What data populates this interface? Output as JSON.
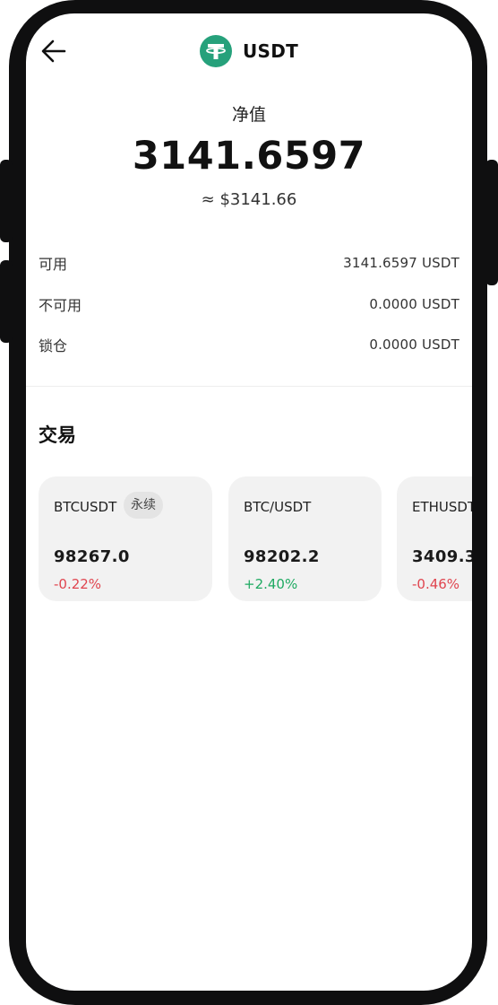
{
  "header": {
    "title": "USDT",
    "logo_icon": "tether-icon",
    "logo_color": "#26a17b"
  },
  "balance": {
    "label": "净值",
    "value": "3141.6597",
    "usd": "≈ $3141.66"
  },
  "rows": [
    {
      "label": "可用",
      "value": "3141.6597 USDT"
    },
    {
      "label": "不可用",
      "value": "0.0000 USDT"
    },
    {
      "label": "锁仓",
      "value": "0.0000 USDT"
    }
  ],
  "trade": {
    "title": "交易",
    "cards": [
      {
        "name": "BTCUSDT",
        "badge": "永续",
        "price": "98267.0",
        "change": "-0.22%"
      },
      {
        "name": "BTC/USDT",
        "price": "98202.2",
        "change": "+2.40%"
      },
      {
        "name": "ETHUSDT",
        "price": "3409.3",
        "change": "-0.46%"
      }
    ]
  },
  "colors": {
    "negative": "#e0454f",
    "positive": "#1faa62"
  }
}
